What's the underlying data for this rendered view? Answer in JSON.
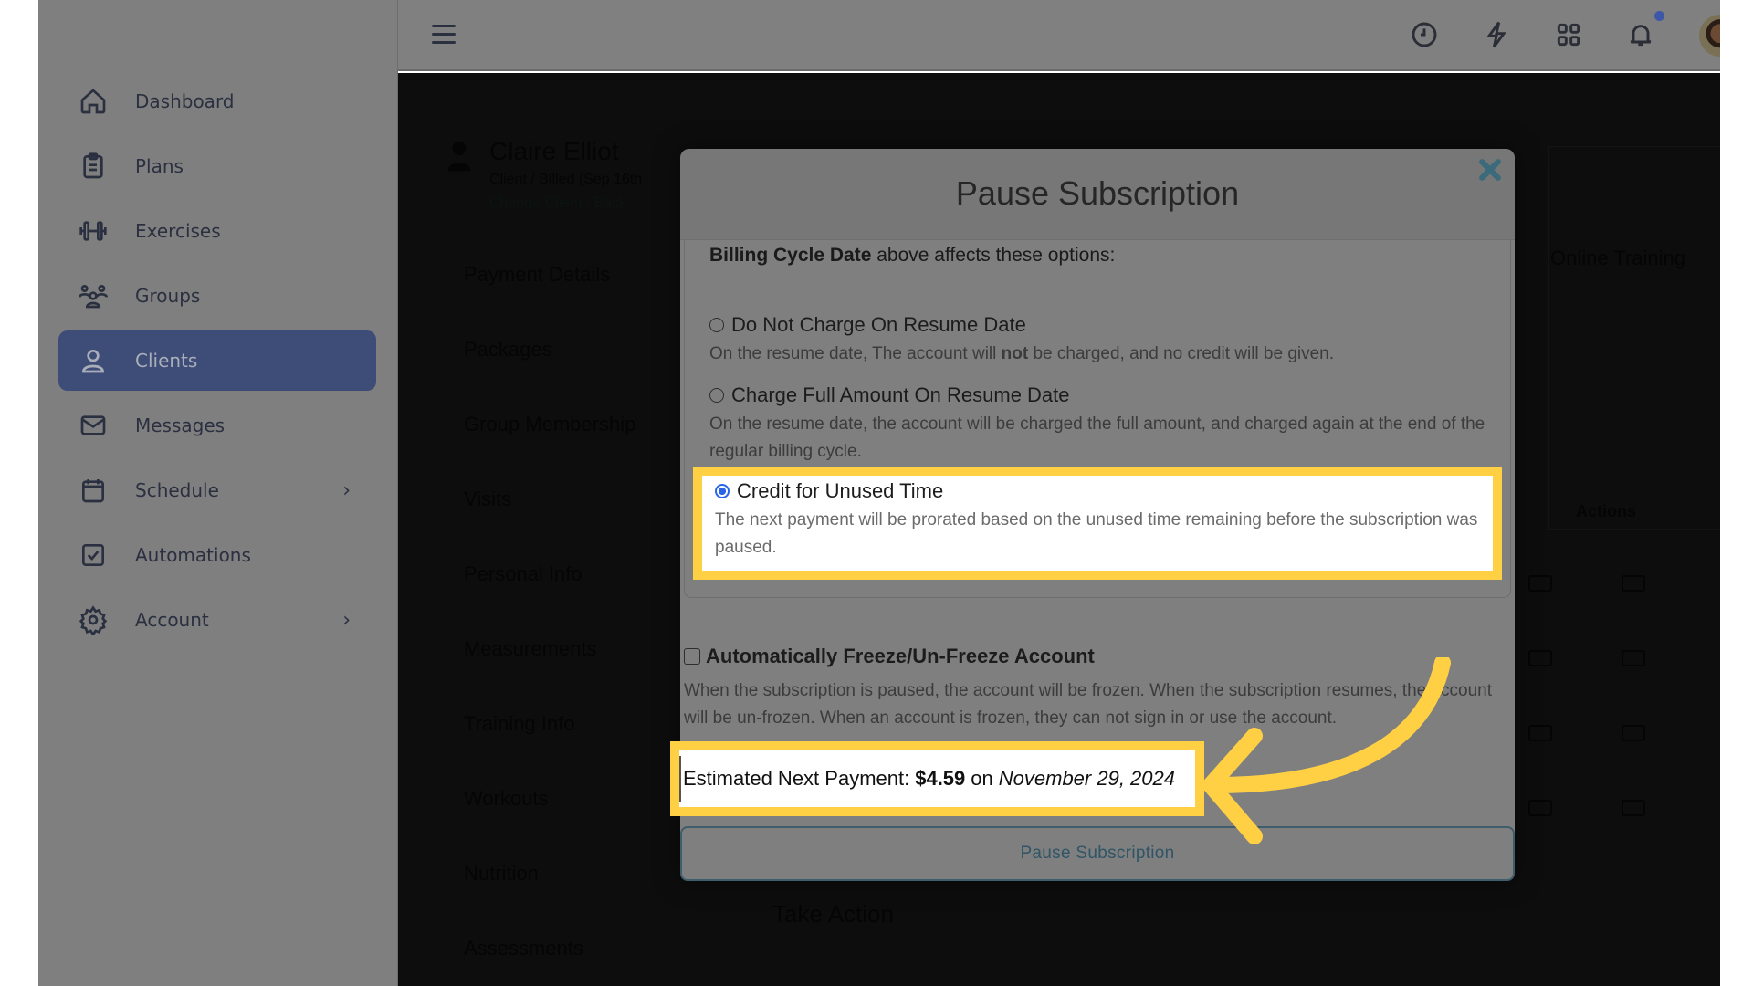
{
  "sidebar": {
    "items": [
      {
        "label": "Dashboard",
        "icon": "home-icon",
        "active": false,
        "has_submenu": false
      },
      {
        "label": "Plans",
        "icon": "clipboard-icon",
        "active": false,
        "has_submenu": false
      },
      {
        "label": "Exercises",
        "icon": "dumbbell-icon",
        "active": false,
        "has_submenu": false
      },
      {
        "label": "Groups",
        "icon": "users-icon",
        "active": false,
        "has_submenu": false
      },
      {
        "label": "Clients",
        "icon": "user-icon",
        "active": true,
        "has_submenu": false
      },
      {
        "label": "Messages",
        "icon": "envelope-icon",
        "active": false,
        "has_submenu": false
      },
      {
        "label": "Schedule",
        "icon": "calendar-icon",
        "active": false,
        "has_submenu": true
      },
      {
        "label": "Automations",
        "icon": "checkbox-icon",
        "active": false,
        "has_submenu": false
      },
      {
        "label": "Account",
        "icon": "gear-icon",
        "active": false,
        "has_submenu": true
      }
    ],
    "chevron": "›",
    "active_color": "#3e4c78"
  },
  "topbar": {
    "icons": [
      "clock-icon",
      "lightning-icon",
      "grid-icon",
      "bell-icon"
    ],
    "notification_dot_color": "#3e57a8"
  },
  "background": {
    "client_name": "Claire Elliot",
    "client_subtitle": "Client / Billed (Sep 16th",
    "client_links": "Change Client / Back",
    "tabs": [
      "Payment Details",
      "Packages",
      "Group Membership",
      "Visits",
      "Personal Info",
      "Measurements",
      "Training Info",
      "Workouts",
      "Nutrition",
      "Assessments"
    ],
    "online_training": "Online Training",
    "actions_header": "Actions",
    "take_action": "Take Action"
  },
  "modal": {
    "title": "Pause Subscription",
    "close_icon": "✖",
    "intro_bold": "Billing Cycle Date",
    "intro_rest": " above affects these options:",
    "options": [
      {
        "label": "Do Not Charge On Resume Date",
        "desc_pre": "On the resume date, The account will ",
        "desc_bold": "not",
        "desc_post": " be charged, and no credit will be given.",
        "selected": false
      },
      {
        "label": "Charge Full Amount On Resume Date",
        "desc": "On the resume date, the account will be charged the full amount, and charged again at the end of the regular billing cycle.",
        "selected": false
      },
      {
        "label": "Credit for Unused Time",
        "desc": "The next payment will be prorated based on the unused time remaining before the subscription was paused.",
        "selected": true
      }
    ],
    "freeze": {
      "label": "Automatically Freeze/Un-Freeze Account",
      "checked": false,
      "desc": "When the subscription is paused, the account will be frozen. When the subscription resumes, the account will be un-frozen. When an account is frozen, they can not sign in or use the account."
    },
    "estimate": {
      "prefix": "Estimated Next Payment:",
      "amount": "$4.59",
      "on": "on",
      "date": "November 29, 2024"
    },
    "submit_label": "Pause Subscription",
    "highlight_color": "#ffd043"
  }
}
